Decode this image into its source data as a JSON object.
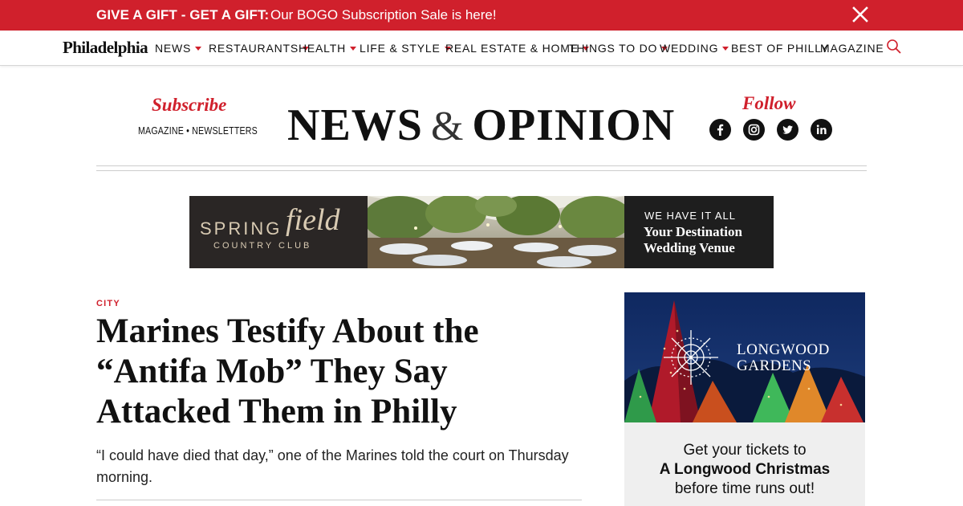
{
  "promo": {
    "bold": "GIVE A GIFT - GET A GIFT:",
    "text": "Our BOGO Subscription Sale is here!"
  },
  "nav": {
    "logo": "Philadelphia",
    "items": [
      {
        "label": "NEWS",
        "dropdown": true
      },
      {
        "label": "RESTAURANTS",
        "dropdown": true
      },
      {
        "label": "HEALTH",
        "dropdown": true
      },
      {
        "label": "LIFE & STYLE",
        "dropdown": true
      },
      {
        "label": "REAL ESTATE & HOME",
        "dropdown": true
      },
      {
        "label": "THINGS TO DO",
        "dropdown": true
      },
      {
        "label": "WEDDING",
        "dropdown": true
      },
      {
        "label": "BEST OF PHILLY",
        "dropdown": false
      },
      {
        "label": "MAGAZINE",
        "dropdown": false
      }
    ]
  },
  "masthead": {
    "subscribe": "Subscribe",
    "magazine_link": "MAGAZINE",
    "separator": "•",
    "newsletters_link": "NEWSLETTERS",
    "title_left": "NEWS",
    "title_amp": "&",
    "title_right": "OPINION",
    "follow": "Follow",
    "social": [
      "facebook-icon",
      "instagram-icon",
      "twitter-icon",
      "linkedin-icon"
    ]
  },
  "banner_ad": {
    "brand_a": "SPRING",
    "brand_b": "field",
    "brand_sub": "COUNTRY CLUB",
    "tagline": "WE HAVE IT ALL",
    "headline_1": "Your Destination",
    "headline_2": "Wedding Venue"
  },
  "article": {
    "kicker": "CITY",
    "headline": "Marines Testify About the “Antifa Mob” They Say Attacked Them in Philly",
    "dek": "“I could have died that day,” one of the Marines told the court on Thursday morning."
  },
  "side_ad": {
    "brand_1": "LONGWOOD",
    "brand_2": "GARDENS",
    "line1": "Get your tickets to",
    "line2": "A Longwood Christmas",
    "line3": "before time runs out!"
  },
  "colors": {
    "accent": "#d0202c",
    "text": "#111111"
  }
}
